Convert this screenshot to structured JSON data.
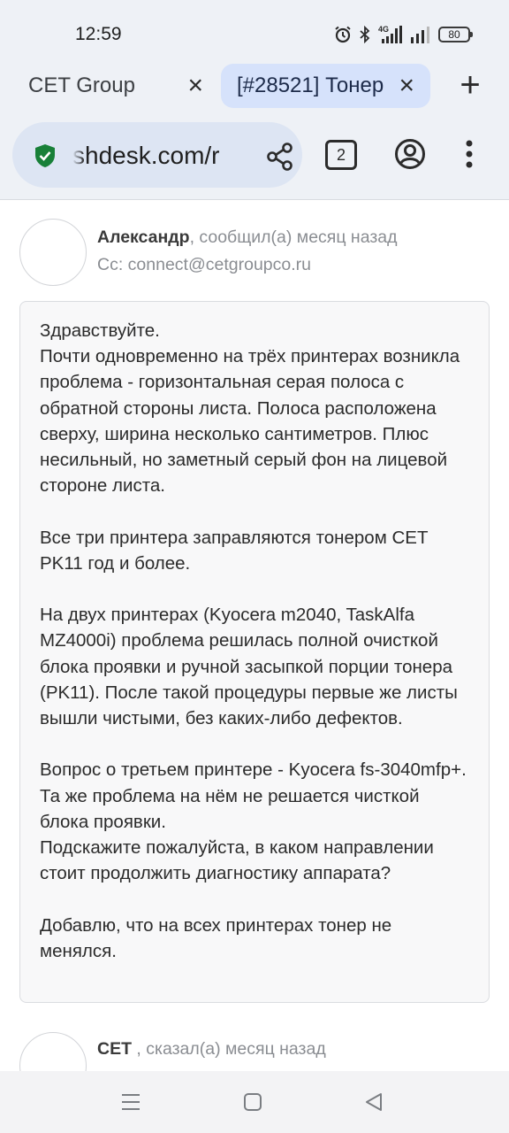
{
  "status": {
    "time": "12:59",
    "network": "4G",
    "battery": "80",
    "icons": [
      "alarm-icon",
      "bluetooth-icon",
      "signal-4g-icon",
      "signal-icon",
      "battery-icon"
    ]
  },
  "tabs": [
    {
      "title": "CET Group",
      "active": false
    },
    {
      "title": "[#28521] Тонер",
      "active": true
    }
  ],
  "toolbar": {
    "url": "deskshdesk.com/helpdesk",
    "url_visible": "shdesk.com/r",
    "tab_count": "2",
    "colors": {
      "shield": "#188038",
      "active_tab": "#d6e2fb"
    }
  },
  "posts": [
    {
      "author": "Александр",
      "action": ", сообщил(а) месяц назад",
      "cc": "Cc: connect@cetgroupco.ru",
      "body": [
        "Здравствуйте.\nПочти одновременно на трёх принтерах возникла проблема - горизонтальная серая полоса с обратной стороны листа. Полоса расположена сверху, ширина несколько сантиметров. Плюс несильный, но заметный серый фон на лицевой стороне листа.",
        "Все три принтера заправляются тонером СЕТ PK11 год и более.",
        "На двух принтерах (Kyocera m2040, TaskAlfa MZ4000i) проблема решилась полной очисткой блока проявки и ручной засыпкой порции тонера (PK11). После такой процедуры первые же листы вышли чистыми, без каких-либо дефектов.",
        "Вопрос о третьем принтере - Kyocera fs-3040mfp+. Та же проблема на нём не решается чисткой блока проявки.\nПодскажите пожалуйста, в каком направлении стоит продолжить диагностику аппарата?",
        "Добавлю, что на всех принтерах тонер не менялся."
      ]
    },
    {
      "author": "CET",
      "action": " , сказал(а) месяц назад"
    }
  ]
}
